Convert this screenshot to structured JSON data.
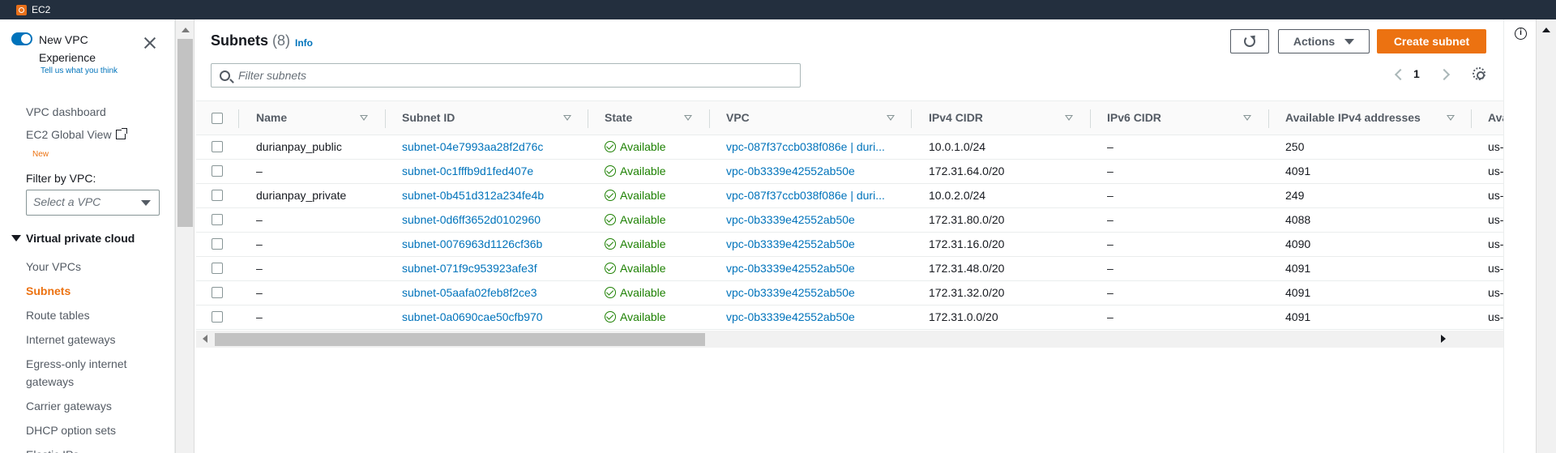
{
  "topbar": {
    "service": "EC2",
    "icon": "ec2-icon"
  },
  "sidebar": {
    "toggle_label": "New VPC Experience",
    "feedback_link": "Tell us what you think",
    "links": [
      {
        "label": "VPC dashboard"
      },
      {
        "label": "EC2 Global View",
        "badge": "New"
      }
    ],
    "filter_label": "Filter by VPC:",
    "filter_placeholder": "Select a VPC",
    "section_title": "Virtual private cloud",
    "items": [
      {
        "label": "Your VPCs"
      },
      {
        "label": "Subnets",
        "active": true
      },
      {
        "label": "Route tables"
      },
      {
        "label": "Internet gateways"
      },
      {
        "label": "Egress-only internet gateways"
      },
      {
        "label": "Carrier gateways"
      },
      {
        "label": "DHCP option sets"
      },
      {
        "label": "Elastic IPs"
      }
    ]
  },
  "header": {
    "title": "Subnets",
    "count": "(8)",
    "info": "Info",
    "actions_label": "Actions",
    "create_label": "Create subnet",
    "filter_placeholder": "Filter subnets",
    "page": "1"
  },
  "table": {
    "columns": [
      "Name",
      "Subnet ID",
      "State",
      "VPC",
      "IPv4 CIDR",
      "IPv6 CIDR",
      "Available IPv4 addresses",
      "Ava"
    ],
    "rows": [
      {
        "name": "durianpay_public",
        "subnet_id": "subnet-04e7993aa28f2d76c",
        "state": "Available",
        "vpc": "vpc-087f37ccb038f086e | duri...",
        "ipv4": "10.0.1.0/24",
        "ipv6": "–",
        "avail": "250",
        "az": "us-e"
      },
      {
        "name": "–",
        "subnet_id": "subnet-0c1fffb9d1fed407e",
        "state": "Available",
        "vpc": "vpc-0b3339e42552ab50e",
        "ipv4": "172.31.64.0/20",
        "ipv6": "–",
        "avail": "4091",
        "az": "us-e"
      },
      {
        "name": "durianpay_private",
        "subnet_id": "subnet-0b451d312a234fe4b",
        "state": "Available",
        "vpc": "vpc-087f37ccb038f086e | duri...",
        "ipv4": "10.0.2.0/24",
        "ipv6": "–",
        "avail": "249",
        "az": "us-e"
      },
      {
        "name": "–",
        "subnet_id": "subnet-0d6ff3652d0102960",
        "state": "Available",
        "vpc": "vpc-0b3339e42552ab50e",
        "ipv4": "172.31.80.0/20",
        "ipv6": "–",
        "avail": "4088",
        "az": "us-e"
      },
      {
        "name": "–",
        "subnet_id": "subnet-0076963d1126cf36b",
        "state": "Available",
        "vpc": "vpc-0b3339e42552ab50e",
        "ipv4": "172.31.16.0/20",
        "ipv6": "–",
        "avail": "4090",
        "az": "us-e"
      },
      {
        "name": "–",
        "subnet_id": "subnet-071f9c953923afe3f",
        "state": "Available",
        "vpc": "vpc-0b3339e42552ab50e",
        "ipv4": "172.31.48.0/20",
        "ipv6": "–",
        "avail": "4091",
        "az": "us-e"
      },
      {
        "name": "–",
        "subnet_id": "subnet-05aafa02feb8f2ce3",
        "state": "Available",
        "vpc": "vpc-0b3339e42552ab50e",
        "ipv4": "172.31.32.0/20",
        "ipv6": "–",
        "avail": "4091",
        "az": "us-e"
      },
      {
        "name": "–",
        "subnet_id": "subnet-0a0690cae50cfb970",
        "state": "Available",
        "vpc": "vpc-0b3339e42552ab50e",
        "ipv4": "172.31.0.0/20",
        "ipv6": "–",
        "avail": "4091",
        "az": "us-e"
      }
    ]
  },
  "colors": {
    "accent": "#ec7211",
    "link": "#0073bb",
    "success": "#1d8102",
    "topbar": "#232f3e"
  }
}
